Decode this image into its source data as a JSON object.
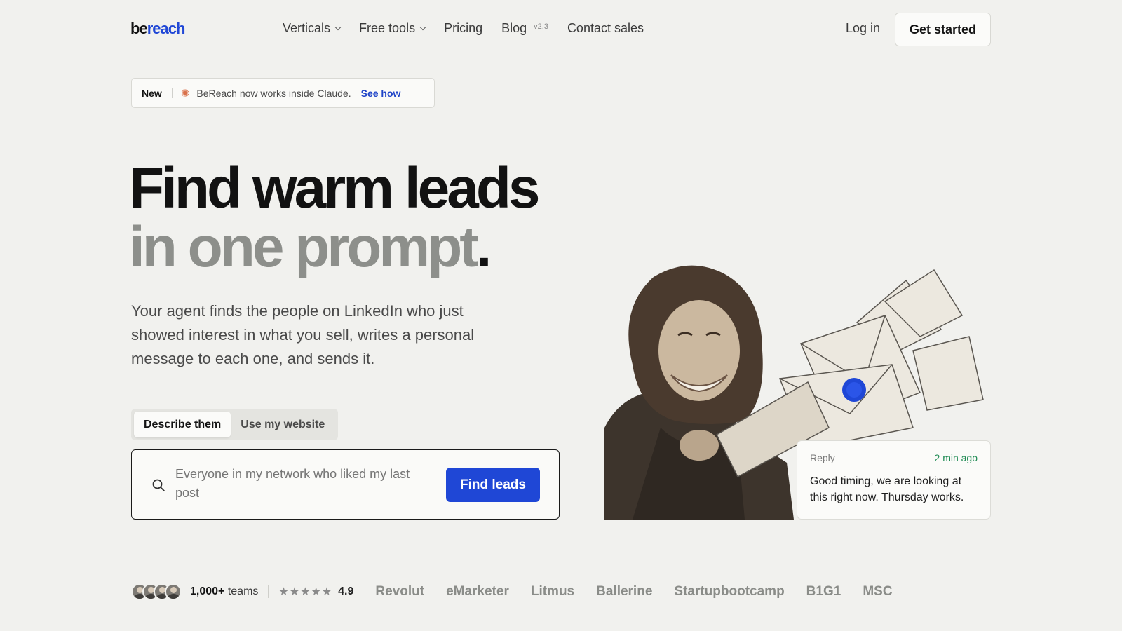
{
  "nav": {
    "logo_part1": "be",
    "logo_part2": "reach",
    "links": [
      {
        "label": "Verticals"
      },
      {
        "label": "Free tools"
      },
      {
        "label": "Pricing"
      },
      {
        "label": "Blog",
        "version": "v2.3"
      },
      {
        "label": "Contact sales"
      }
    ],
    "login": "Log in",
    "cta": "Get started"
  },
  "announcement": {
    "badge": "New",
    "text": "BeReach now works inside Claude.",
    "link": "See how"
  },
  "hero": {
    "line1": "Find warm leads",
    "line2": "in one prompt",
    "line2_end": ".",
    "lede": "Your agent finds the people on LinkedIn who just showed interest in what you sell, writes a personal message to each one, and sends it."
  },
  "tabs": [
    "Describe them",
    "Use my website"
  ],
  "search": {
    "placeholder": "Everyone in my network who liked my last post",
    "button": "Find leads"
  },
  "reply_card": {
    "label": "Reply",
    "time": "2 min ago",
    "body": "Good timing, we are looking at this right now. Thursday works."
  },
  "trust": {
    "count": "1,000+",
    "count_suffix": " teams",
    "stars": "★★★★★",
    "rating": "4.9",
    "logos": [
      "Revolut",
      "eMarketer",
      "Litmus",
      "Ballerine",
      "Startupbootcamp",
      "B1G1",
      "MSC"
    ]
  },
  "colors": {
    "background": "#f1f1ee",
    "accent": "#1f47d6",
    "reply_time": "#1d8a52"
  }
}
